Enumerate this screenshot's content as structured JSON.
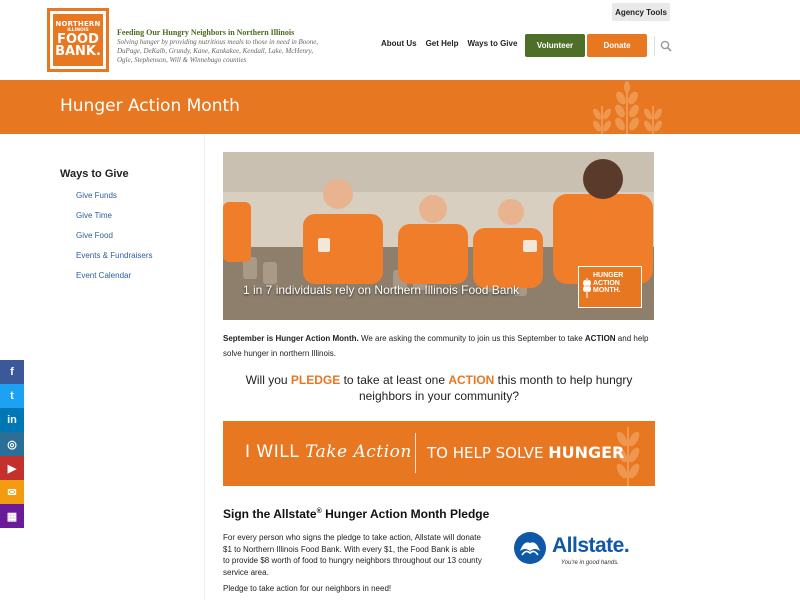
{
  "header": {
    "logo": {
      "line1": "NORTHERN",
      "line2": "ILLINOIS",
      "line3": "FOOD",
      "line4": "BANK."
    },
    "tagline_title": "Feeding Our Hungry Neighbors in Northern Illinois",
    "tagline_text": "Solving hunger by providing nutritious meals to those in need in Boone, DuPage, DeKalb, Grundy, Kane, Kankakee, Kendall, Lake, McHenry, Ogle, Stephenson, Will & Winnebago counties",
    "agency_tools": "Agency Tools",
    "nav": [
      "About Us",
      "Get Help",
      "Ways to Give"
    ],
    "volunteer": "Volunteer",
    "donate": "Donate",
    "search_icon": "search-icon"
  },
  "banner": {
    "title": "Hunger Action Month"
  },
  "sidebar": {
    "title": "Ways to Give",
    "items": [
      "Give Funds",
      "Give Time",
      "Give Food",
      "Events & Fundraisers",
      "Event Calendar"
    ]
  },
  "hero": {
    "caption": "1 in 7 individuals rely on Northern Illinois Food Bank",
    "badge": {
      "l1": "HUNGER",
      "l2": "ACTION",
      "l3": "MONTH."
    }
  },
  "intro": {
    "bold1": "September is Hunger Action Month.",
    "text1": " We are asking the community to join us this September to take ",
    "bold2": "ACTION",
    "text2": " and help solve hunger in northern Illinois."
  },
  "pledge_question": {
    "p1": "Will you ",
    "hl1": "PLEDGE",
    "p2": " to take at least one ",
    "hl2": "ACTION",
    "p3": " this month to help hungry neighbors in your community?"
  },
  "action_banner": {
    "left_a": "I WILL ",
    "left_b": "Take Action",
    "right_a": "TO HELP SOLVE ",
    "right_b": "HUNGER"
  },
  "sign": {
    "title_a": "Sign the Allstate",
    "title_reg": "®",
    "title_b": " Hunger Action Month Pledge",
    "body": "For every person who signs the pledge to take action, Allstate will donate $1 to Northern Illinois Food Bank. With every $1, the Food Bank is able to provide $8 worth of food to hungry neighbors throughout our 13 county service area.",
    "body2": "Pledge to take action for our neighbors in need!"
  },
  "allstate": {
    "word": "Allstate.",
    "tag": "You're in good hands."
  },
  "social": [
    {
      "icon": "facebook-icon",
      "glyph": "f",
      "color": "#3b5998"
    },
    {
      "icon": "twitter-icon",
      "glyph": "t",
      "color": "#1da1f2"
    },
    {
      "icon": "linkedin-icon",
      "glyph": "in",
      "color": "#0077b5"
    },
    {
      "icon": "instagram-icon",
      "glyph": "◎",
      "color": "#2a6f97"
    },
    {
      "icon": "youtube-icon",
      "glyph": "▶",
      "color": "#c4302b"
    },
    {
      "icon": "email-icon",
      "glyph": "✉",
      "color": "#f39c12"
    },
    {
      "icon": "calendar-icon",
      "glyph": "▦",
      "color": "#6a1b9a"
    }
  ],
  "colors": {
    "brand_orange": "#e87722",
    "brand_green": "#4e6f27",
    "link_blue": "#2d5f9a"
  }
}
